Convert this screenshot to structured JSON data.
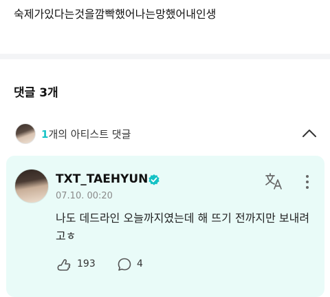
{
  "post": {
    "text": "숙제가있다는것을깜빡했어나는망했어내인생"
  },
  "comments": {
    "header": "댓글 3개",
    "artist_count": "1",
    "artist_label": "개의 아티스트 댓글",
    "collapse_icon": "chevron-up-icon"
  },
  "comment": {
    "author": "TXT_TAEHYUN",
    "verified_icon": "verified-badge-icon",
    "timestamp": "07.10. 00:20",
    "text": "나도 데드라인 오늘까지였는데 해 뜨기 전까지만 보내려고ㅎ",
    "likes": "193",
    "replies": "4",
    "translate_icon": "translate-icon",
    "more_icon": "more-vertical-icon"
  },
  "colors": {
    "accent": "#19c3c6",
    "card_background": "#e9fbf8",
    "verified": "#14c2c5"
  }
}
